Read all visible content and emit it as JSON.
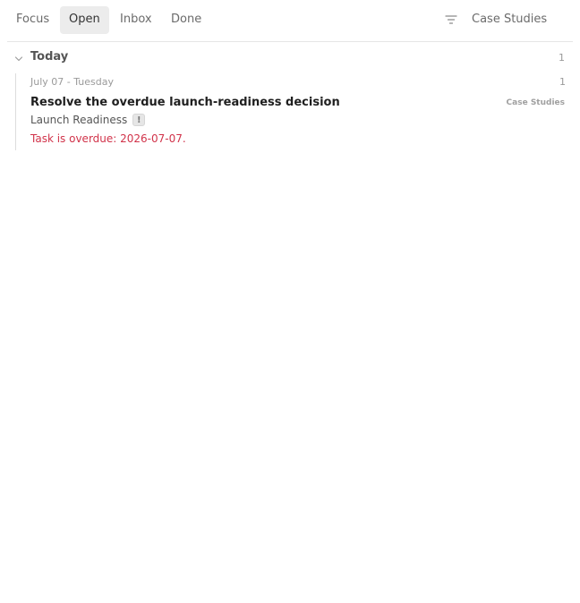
{
  "tabs": [
    {
      "label": "Focus",
      "active": false
    },
    {
      "label": "Open",
      "active": true
    },
    {
      "label": "Inbox",
      "active": false
    },
    {
      "label": "Done",
      "active": false
    }
  ],
  "filter": {
    "icon": "filter-icon"
  },
  "project_selector": {
    "label": "Case Studies"
  },
  "group": {
    "icon": "chevron-down-icon",
    "title": "Today",
    "count": "1"
  },
  "day": {
    "label": "July 07 - Tuesday",
    "count": "1"
  },
  "task": {
    "title": "Resolve the overdue launch-readiness decision",
    "project_tag": "Case Studies",
    "area": "Launch Readiness",
    "priority_badge": "!",
    "overdue_note": "Task is overdue: 2026-07-07."
  },
  "colors": {
    "overdue_text": "#d1334a",
    "active_tab_bg": "#ececec"
  }
}
